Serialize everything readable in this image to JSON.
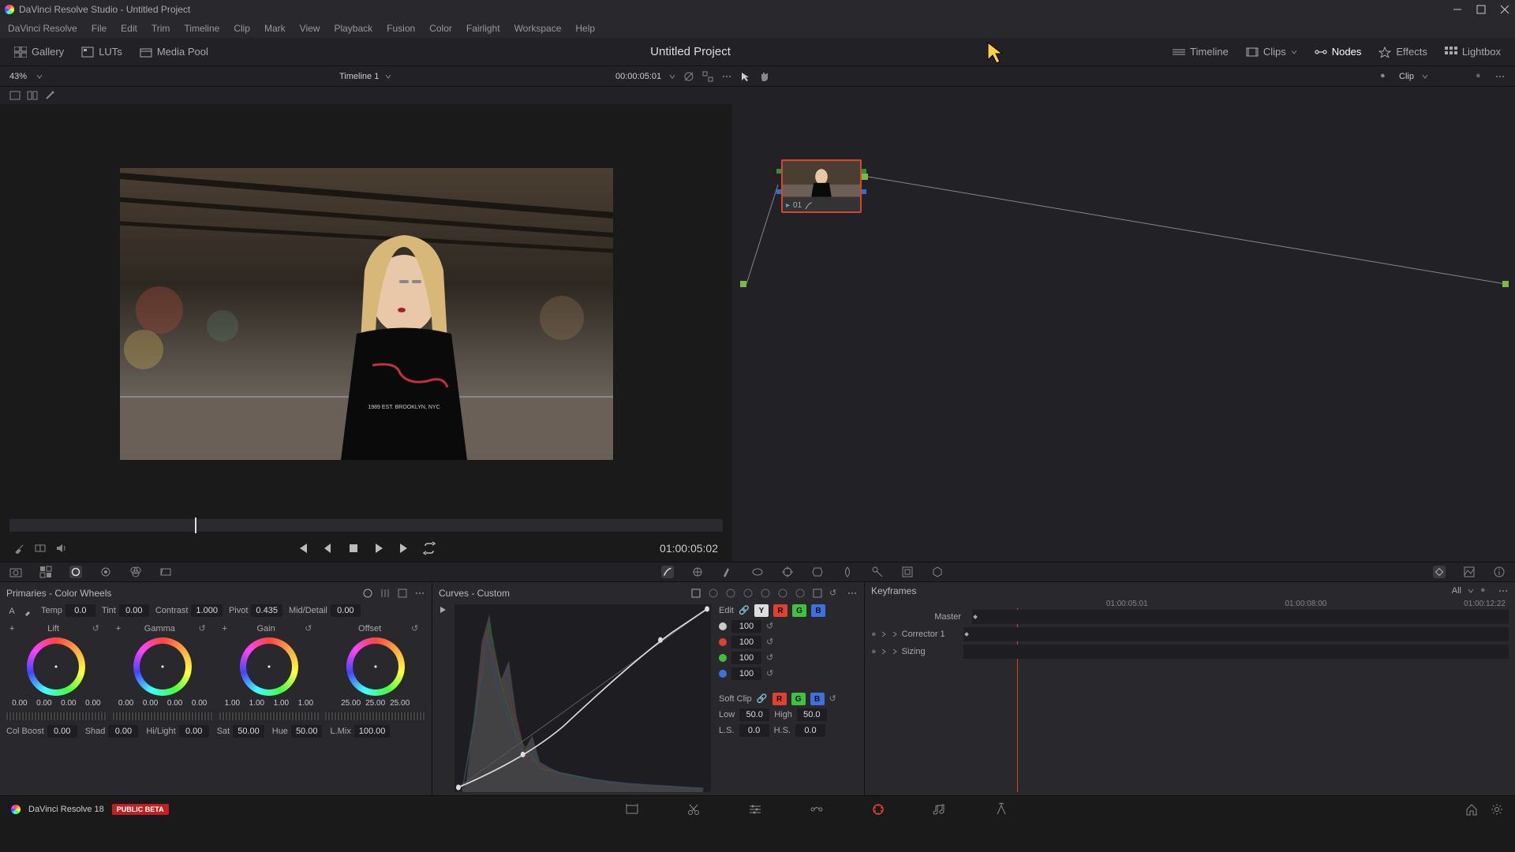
{
  "titlebar": {
    "text": "DaVinci Resolve Studio - Untitled Project"
  },
  "menubar": [
    "DaVinci Resolve",
    "File",
    "Edit",
    "Trim",
    "Timeline",
    "Clip",
    "Mark",
    "View",
    "Playback",
    "Fusion",
    "Color",
    "Fairlight",
    "Workspace",
    "Help"
  ],
  "toolbar": {
    "left": [
      {
        "label": "Gallery"
      },
      {
        "label": "LUTs"
      },
      {
        "label": "Media Pool"
      }
    ],
    "project_title": "Untitled Project",
    "right": [
      {
        "label": "Timeline"
      },
      {
        "label": "Clips"
      },
      {
        "label": "Nodes"
      },
      {
        "label": "Effects"
      },
      {
        "label": "Lightbox"
      }
    ]
  },
  "subbar": {
    "zoom": "43%",
    "timeline_name": "Timeline 1",
    "timecode": "00:00:05:01",
    "clip_label": "Clip"
  },
  "viewer": {
    "transport_tc": "01:00:05:02"
  },
  "nodes": {
    "node_id": "01"
  },
  "wheels": {
    "title": "Primaries - Color Wheels",
    "adjust": {
      "temp": {
        "label": "Temp",
        "val": "0.0"
      },
      "tint": {
        "label": "Tint",
        "val": "0.00"
      },
      "contrast": {
        "label": "Contrast",
        "val": "1.000"
      },
      "pivot": {
        "label": "Pivot",
        "val": "0.435"
      },
      "middetail": {
        "label": "Mid/Detail",
        "val": "0.00"
      }
    },
    "wheels": [
      {
        "name": "Lift",
        "vals": [
          "0.00",
          "0.00",
          "0.00",
          "0.00"
        ]
      },
      {
        "name": "Gamma",
        "vals": [
          "0.00",
          "0.00",
          "0.00",
          "0.00"
        ]
      },
      {
        "name": "Gain",
        "vals": [
          "1.00",
          "1.00",
          "1.00",
          "1.00"
        ]
      },
      {
        "name": "Offset",
        "vals": [
          "25.00",
          "25.00",
          "25.00"
        ]
      }
    ],
    "bottom": {
      "colboost": {
        "label": "Col Boost",
        "val": "0.00"
      },
      "shad": {
        "label": "Shad",
        "val": "0.00"
      },
      "hilight": {
        "label": "Hi/Light",
        "val": "0.00"
      },
      "sat": {
        "label": "Sat",
        "val": "50.00"
      },
      "hue": {
        "label": "Hue",
        "val": "50.00"
      },
      "lmix": {
        "label": "L.Mix",
        "val": "100.00"
      }
    }
  },
  "curves": {
    "title": "Curves - Custom",
    "edit_label": "Edit",
    "vals": {
      "y": "100",
      "r": "100",
      "g": "100",
      "b": "100"
    },
    "softclip_label": "Soft Clip",
    "low": {
      "label": "Low",
      "val": "50.0"
    },
    "high": {
      "label": "High",
      "val": "50.0"
    },
    "ls": {
      "label": "L.S.",
      "val": "0.0"
    },
    "hs": {
      "label": "H.S.",
      "val": "0.0"
    }
  },
  "keyframes": {
    "title": "Keyframes",
    "all_label": "All",
    "tc_start": "01:00:05:01",
    "tc_mid": "01:00:08:00",
    "tc_end": "01:00:12:22",
    "rows": [
      "Master",
      "Corrector 1",
      "Sizing"
    ]
  },
  "footer": {
    "version": "DaVinci Resolve 18",
    "badge": "PUBLIC BETA"
  }
}
